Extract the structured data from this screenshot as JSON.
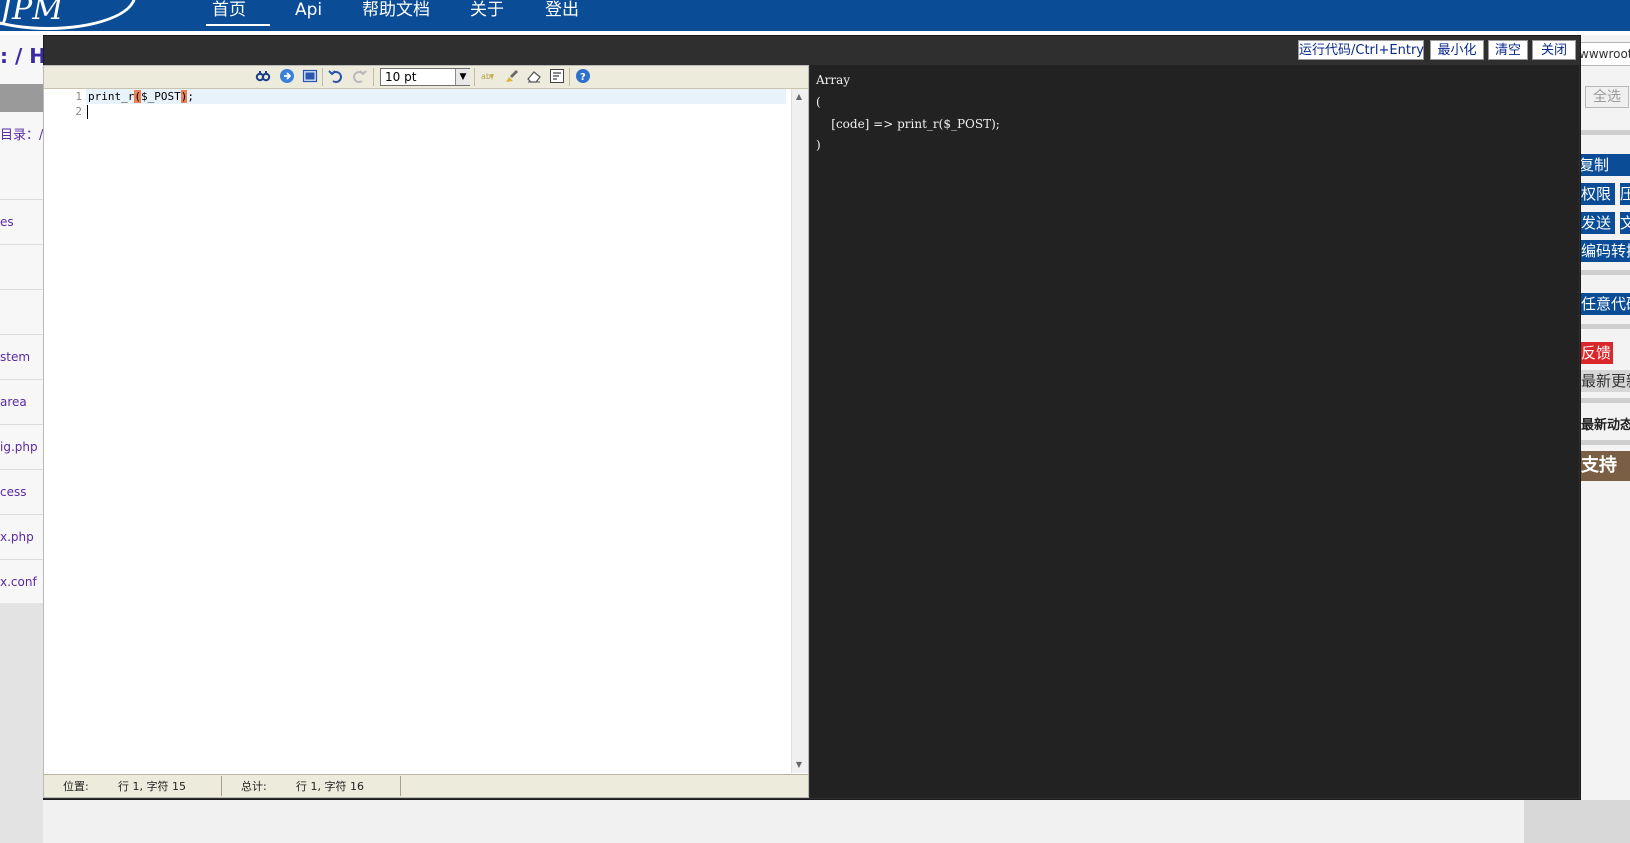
{
  "nav": {
    "logo_text": "JPM",
    "items": [
      "首页",
      "Api",
      "帮助文档",
      "关于",
      "登出"
    ]
  },
  "background": {
    "path_title": ": / H",
    "dir_label": "目录：/",
    "left_items": [
      "es",
      "stem",
      "area",
      "ig.php",
      "cess",
      "x.php",
      "x.conf"
    ],
    "path_input": "wwwroot/",
    "select_all": "全选",
    "buttons": [
      "复制",
      "权限",
      "压",
      "发送",
      "文",
      "编码转换",
      "任意代码"
    ],
    "feedback": "反馈",
    "update": "最新更新",
    "news": "最新动态(本",
    "support": "支持"
  },
  "modal": {
    "run_button": "运行代码/Ctrl+Entry",
    "minimize_button": "最小化",
    "clear_button": "清空",
    "close_button": "关闭"
  },
  "editor": {
    "font_size": "10 pt",
    "line_numbers": [
      "1",
      "2"
    ],
    "code_before": "print_r",
    "code_paren_open": "(",
    "code_inner": "$_POST",
    "code_paren_close": ")",
    "code_after": ";",
    "status": {
      "position_label": "位置:",
      "position_value": "行 1, 字符 15",
      "total_label": "总计:",
      "total_value": "行 1, 字符 16"
    }
  },
  "output": {
    "lines": [
      "Array",
      "(",
      "    [code] => print_r($_POST);",
      ")"
    ]
  },
  "colors": {
    "nav_bg": "#0a4c96",
    "output_bg": "#222222",
    "paren_highlight": "#e98157",
    "current_line": "#e8f2fa",
    "feedback_red": "#d9262b"
  }
}
